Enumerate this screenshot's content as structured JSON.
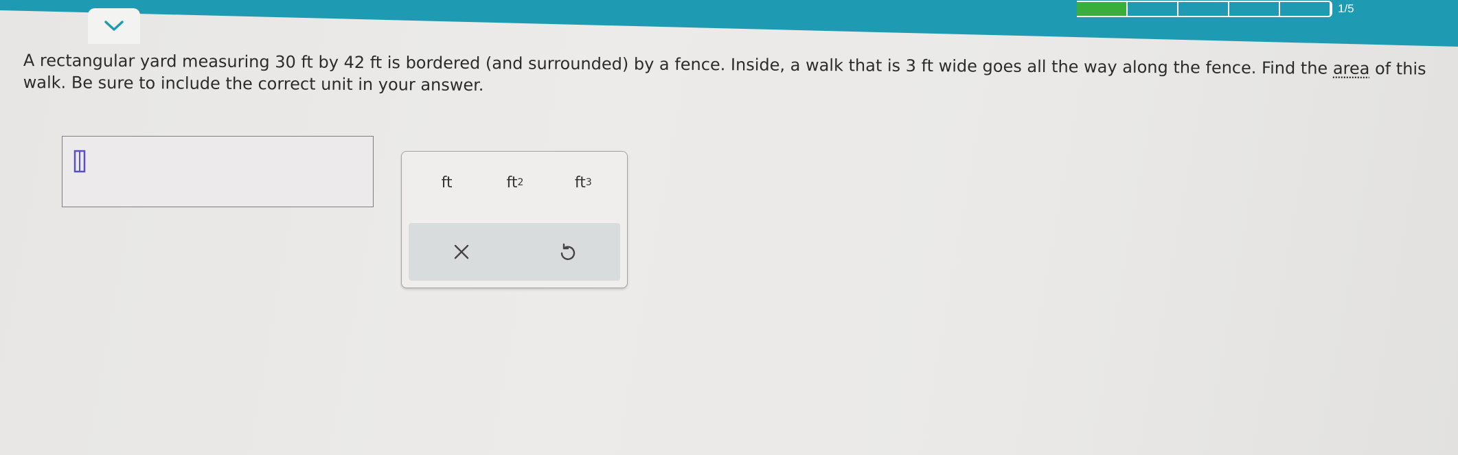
{
  "header": {
    "accent_color": "#1e9bb3",
    "collapse_icon": "chevron-down-icon",
    "progress": {
      "label": "1/5",
      "segments_total": 5,
      "segments_done": 1,
      "done_color": "#3aae3a"
    }
  },
  "question": {
    "text_before": "A rectangular yard measuring 30 ft by 42 ft is bordered (and surrounded) by a fence. Inside, a walk that is 3 ft wide goes all the way along the fence. Find the ",
    "vocab_term": "area",
    "text_after": " of this walk. Be sure to include the correct unit in your answer."
  },
  "answer": {
    "value": "",
    "cursor_icon": "text-cursor-icon"
  },
  "keypad": {
    "units": [
      {
        "base": "ft",
        "exp": ""
      },
      {
        "base": "ft",
        "exp": "2"
      },
      {
        "base": "ft",
        "exp": "3"
      }
    ],
    "clear_icon": "close-icon",
    "undo_icon": "undo-icon"
  }
}
